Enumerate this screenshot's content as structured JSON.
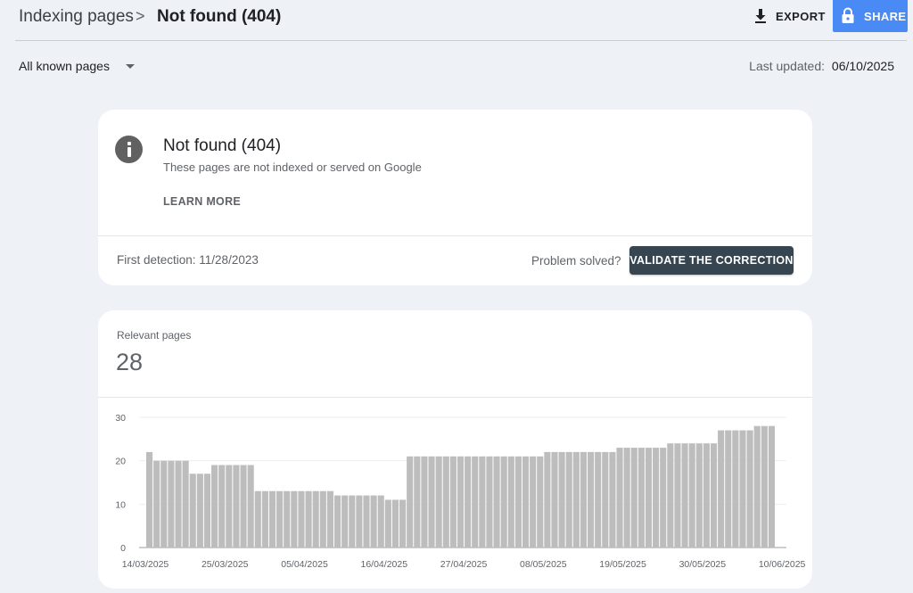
{
  "header": {
    "breadcrumb_parent": "Indexing pages",
    "breadcrumb_separator": ">",
    "breadcrumb_current": "Not found (404)",
    "export_label": "EXPORT",
    "share_label": "SHARE",
    "export_icon": "download-icon",
    "share_icon": "lock-icon"
  },
  "filter": {
    "selected": "All known pages",
    "last_updated_label": "Last updated:",
    "last_updated_value": "06/10/2025"
  },
  "issue": {
    "icon": "info-icon",
    "title": "Not found (404)",
    "description": "These pages are not indexed or served on Google",
    "learn_more": "LEARN MORE",
    "first_detection": "First detection: 11/28/2023",
    "problem_solved": "Problem solved?",
    "validate_label": "VALIDATE THE CORRECTION",
    "validate_color": "#36454f"
  },
  "summary": {
    "label": "Relevant pages",
    "value": "28"
  },
  "colors": {
    "accent": "#4a8af4",
    "bar": "#bdbdbd",
    "background": "#eef2f6"
  },
  "chart_data": {
    "type": "bar",
    "ylim": [
      0,
      30
    ],
    "yticks": [
      "0",
      "10",
      "20",
      "30"
    ],
    "xticks": [
      {
        "index": 0,
        "label": "14/03/2025"
      },
      {
        "index": 11,
        "label": "25/03/2025"
      },
      {
        "index": 22,
        "label": "05/04/2025"
      },
      {
        "index": 33,
        "label": "16/04/2025"
      },
      {
        "index": 44,
        "label": "27/04/2025"
      },
      {
        "index": 55,
        "label": "08/05/2025"
      },
      {
        "index": 66,
        "label": "19/05/2025"
      },
      {
        "index": 77,
        "label": "30/05/2025"
      },
      {
        "index": 88,
        "label": "10/06/2025"
      }
    ],
    "values": [
      22,
      20,
      20,
      20,
      20,
      20,
      17,
      17,
      17,
      19,
      19,
      19,
      19,
      19,
      19,
      13,
      13,
      13,
      13,
      13,
      13,
      13,
      13,
      13,
      13,
      13,
      12,
      12,
      12,
      12,
      12,
      12,
      12,
      11,
      11,
      11,
      21,
      21,
      21,
      21,
      21,
      21,
      21,
      21,
      21,
      21,
      21,
      21,
      21,
      21,
      21,
      21,
      21,
      21,
      21,
      22,
      22,
      22,
      22,
      22,
      22,
      22,
      22,
      22,
      22,
      23,
      23,
      23,
      23,
      23,
      23,
      23,
      24,
      24,
      24,
      24,
      24,
      24,
      24,
      27,
      27,
      27,
      27,
      27,
      28,
      28,
      28
    ]
  }
}
